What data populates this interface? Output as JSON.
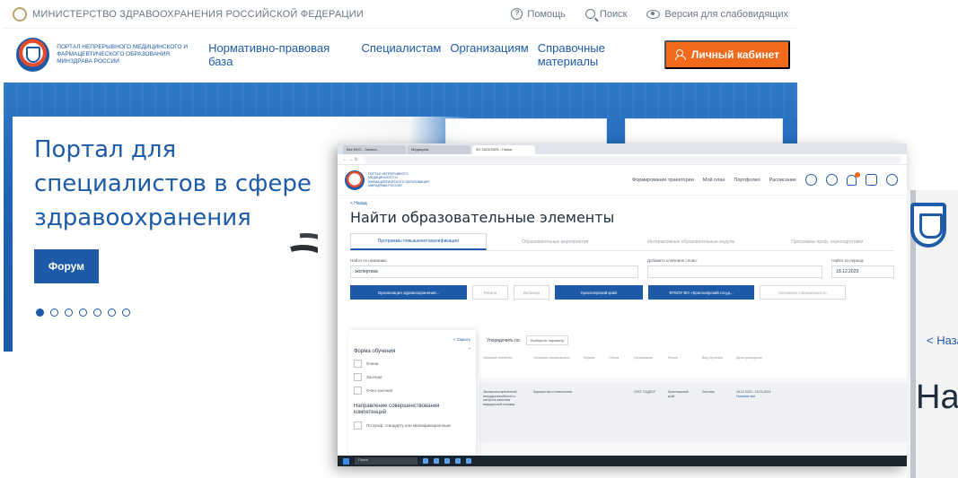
{
  "portal": {
    "topbar": {
      "ministry": "МИНИСТЕРСТВО ЗДРАВООХРАНЕНИЯ РОССИЙСКОЙ ФЕДЕРАЦИИ",
      "help": "Помощь",
      "search": "Поиск",
      "accessibility": "Версия для слабовидящих"
    },
    "logo_text": "ПОРТАЛ НЕПРЕРЫВНОГО МЕДИЦИНСКОГО И ФАРМАЦЕВТИЧЕСКОГО ОБРАЗОВАНИЯ МИНЗДРАВА РОССИИ",
    "nav": [
      "Нормативно-правовая база",
      "Специалистам",
      "Организациям",
      "Справочные материалы"
    ],
    "cabinet_label": "Личный кабинет",
    "hero": {
      "title": "Портал для специалистов в сфере здравоохранения",
      "forum_label": "Форум",
      "slides_total": 7,
      "slide_active": 1
    },
    "colors": {
      "brand_blue": "#1d5aa8",
      "accent_orange": "#f26a1b"
    }
  },
  "browser": {
    "tabs": [
      "Все ВНО - Записи...",
      "Медицина",
      "ЗО 2024/2025 - Поиск"
    ],
    "app_nav": [
      "Формирование траектории",
      "Мой план",
      "Портфолио",
      "Расписание"
    ],
    "back_label": "< Назад",
    "page_title": "Найти образовательные элементы",
    "subtabs": [
      "Программы повышения квалификации",
      "Образовательные мероприятия",
      "Интерактивные образовательные модули",
      "Программы проф. переподготовки"
    ],
    "filters": {
      "name_label": "Найти по названию:",
      "name_value": "экспертиза",
      "keywords_label": "Добавить ключевое слово:",
      "period_label": "Найти за период:",
      "period_value": "18.12.2023"
    },
    "buttons": [
      "Организация здравоохранения...",
      "Регион",
      "Вебинар",
      "Красноярский край",
      "ФГБОУ ВО «Красноярский госуд...",
      "Основная специальность"
    ],
    "sidebar": {
      "collapse_label": "< Скрыть",
      "form_heading": "Форма обучения",
      "forms": [
        "Очная",
        "Заочная",
        "Очно-заочная"
      ],
      "direction_heading": "Направление совершенствования компетенций",
      "direction_option": "По проф. стандарту или квалификационным"
    },
    "sort": {
      "label": "Упорядочить по:",
      "value": "Выберите параметр"
    },
    "columns": [
      "Название элемента",
      "Основная специальность",
      "Формат",
      "Объем",
      "Организация",
      "Регион",
      "Вид обучения",
      "Даты проведения"
    ],
    "row": {
      "name": "Экспертиза временной нетрудоспособности и контроль качества медицинской помощи",
      "specialty": "Акушерство и гинекология",
      "organization": "ООО \"СЦДПО\"",
      "region": "Красноярский край",
      "mode": "Заочная",
      "dates": "18.12.2023 - 15.01.2024",
      "more": "Показать все"
    },
    "taskbar_search": "Поиск"
  },
  "right_fragment": {
    "back": "< Наза",
    "big": "Най",
    "logo_letters": "п\nм\nи\nс"
  }
}
